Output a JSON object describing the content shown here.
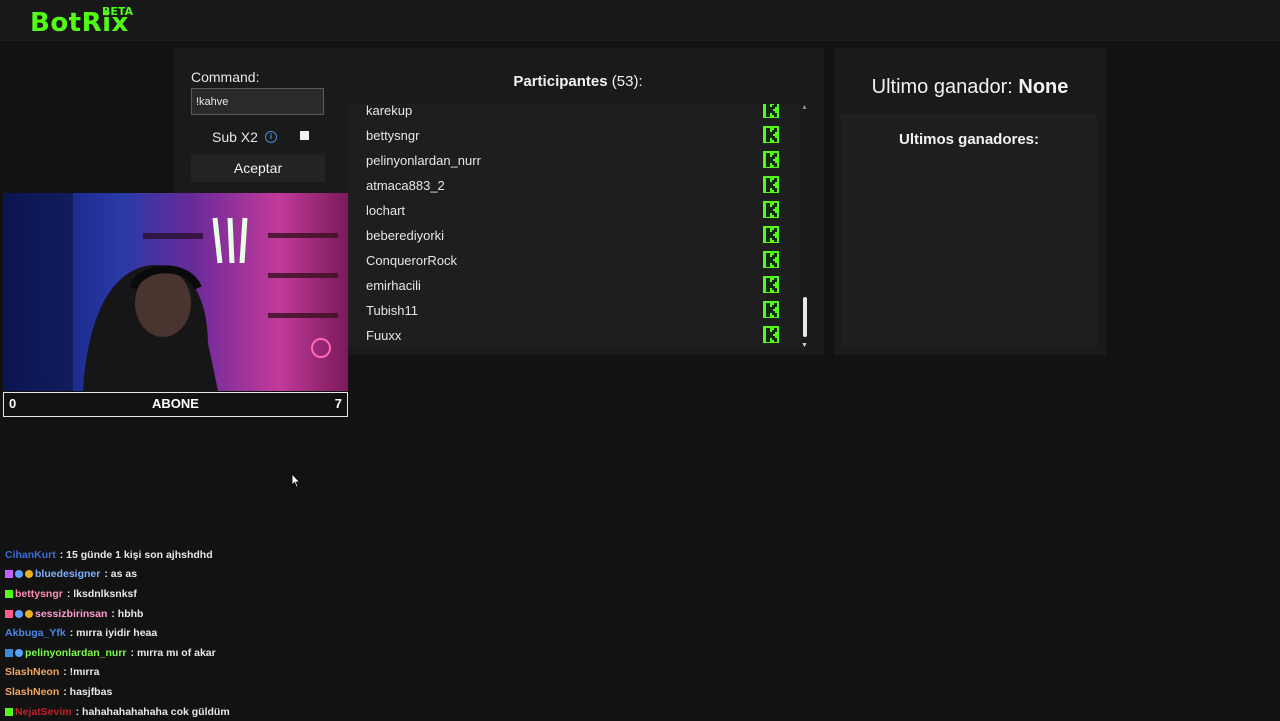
{
  "app": {
    "logo": "BotRix",
    "beta": "BETA"
  },
  "command": {
    "label": "Command:",
    "value": "!kahve",
    "sub_label": "Sub X2",
    "accept_label": "Aceptar"
  },
  "participants": {
    "title": "Participantes",
    "count": "(53):",
    "items": [
      {
        "name": "karekup"
      },
      {
        "name": "bettysngr"
      },
      {
        "name": "pelinyonlardan_nurr"
      },
      {
        "name": "atmaca883_2"
      },
      {
        "name": "lochart"
      },
      {
        "name": "beberediyorki"
      },
      {
        "name": "ConquerorRock"
      },
      {
        "name": "emirhacili"
      },
      {
        "name": "Tubish11"
      },
      {
        "name": "Fuuxx"
      }
    ]
  },
  "winner": {
    "label": "Ultimo ganador:",
    "value": "None",
    "list_title": "Ultimos ganadores:"
  },
  "goal": {
    "left": "0",
    "label": "ABONE",
    "right": "7"
  },
  "colors": {
    "accent": "#53fc18"
  },
  "chat": [
    {
      "user": "CihanKurt",
      "color": "#3a6bd6",
      "text": ": 15 günde 1 kişi son ajhshdhd",
      "badges": []
    },
    {
      "user": "bluedesigner",
      "color": "#7fb0ff",
      "text": ": as as",
      "badges": [
        "#c061ff",
        "#5aa0ff",
        "#e8b020"
      ]
    },
    {
      "user": "bettysngr",
      "color": "#ff8fb0",
      "text": ": lksdnlksnksf",
      "badges": [
        "#53fc18"
      ]
    },
    {
      "user": "sessizbirinsan",
      "color": "#ff9bd0",
      "text": ": hbhb",
      "badges": [
        "#ff5a8a",
        "#5aa0ff",
        "#e8b020"
      ]
    },
    {
      "user": "Akbuga_Yfk",
      "color": "#4a86e8",
      "text": ": mırra iyidir heaa",
      "badges": []
    },
    {
      "user": "pelinyonlardan_nurr",
      "color": "#7cfc4a",
      "text": ": mırra mı of akar",
      "badges": [
        "#3a8ad8",
        "#5aa0ff"
      ]
    },
    {
      "user": "SlashNeon",
      "color": "#f0a860",
      "text": ": !mırra",
      "badges": []
    },
    {
      "user": "SlashNeon",
      "color": "#f0a860",
      "text": ": hasjfbas",
      "badges": []
    },
    {
      "user": "NejatSevim",
      "color": "#c0202a",
      "text": ": hahahahahahaha cok güldüm",
      "badges": [
        "#53fc18"
      ]
    }
  ]
}
